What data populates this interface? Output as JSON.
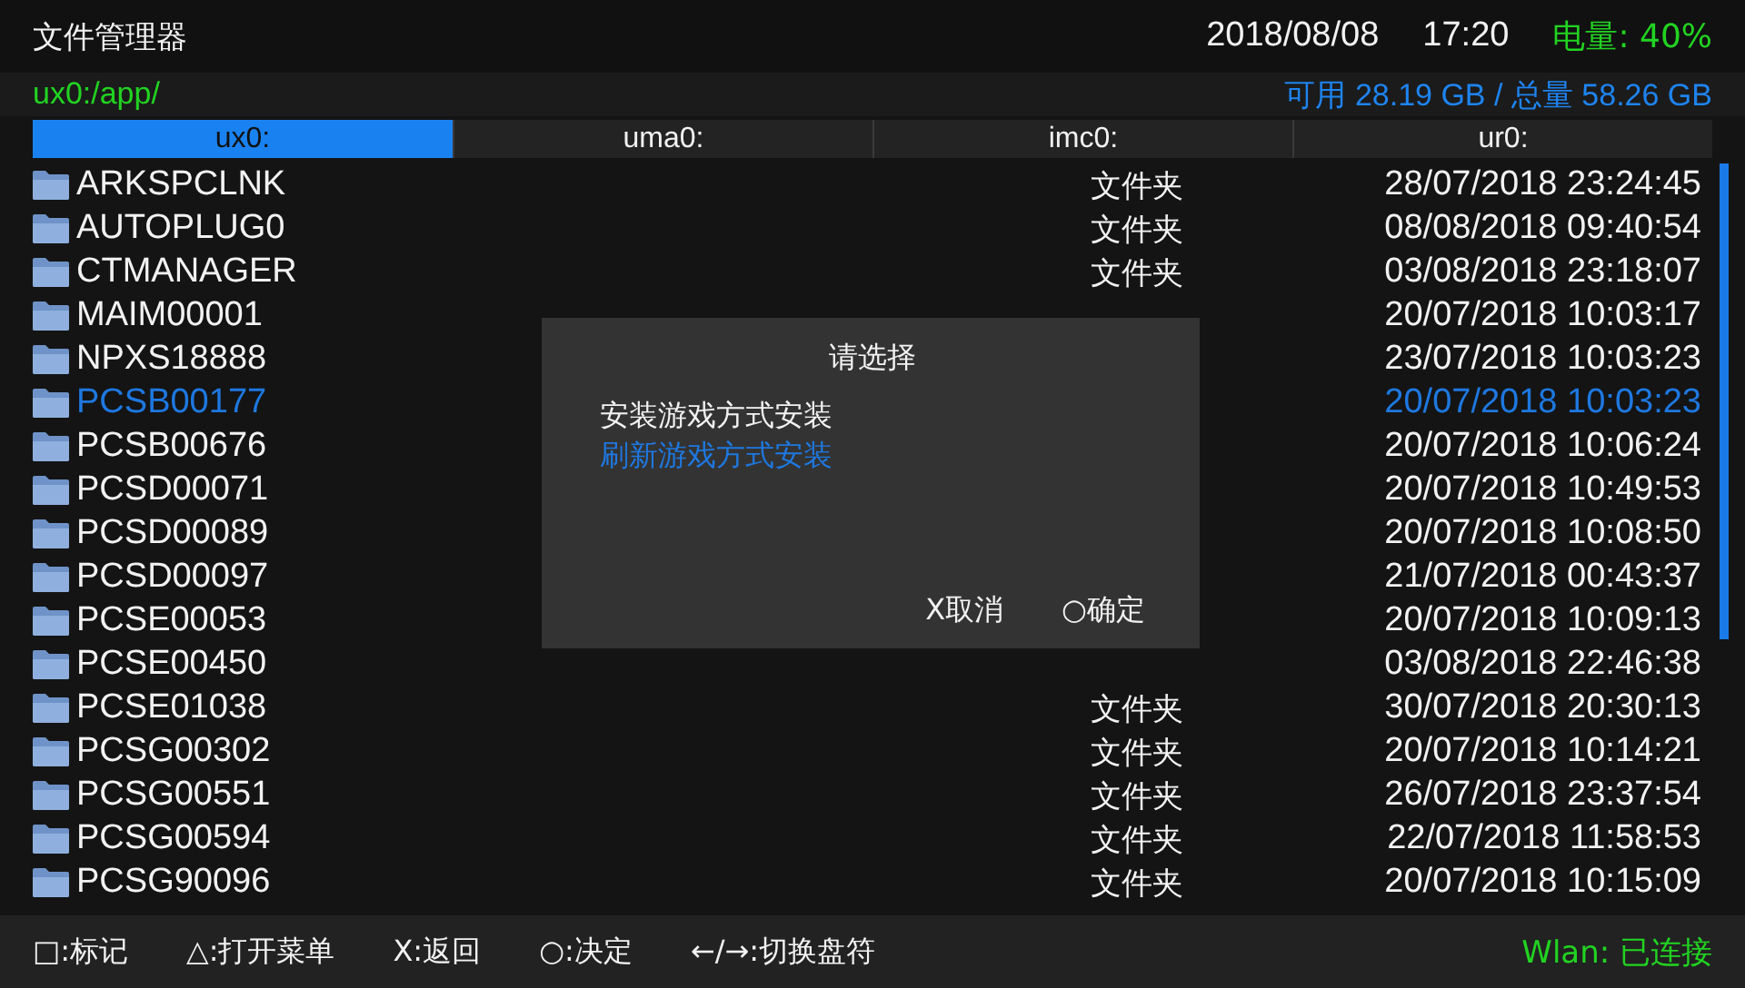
{
  "header": {
    "title": "文件管理器",
    "date": "2018/08/08",
    "time": "17:20",
    "battery": "电量: 40%"
  },
  "path": "ux0:/app/",
  "storage": "可用 28.19 GB  /  总量 58.26 GB",
  "tabs": [
    {
      "label": "ux0:",
      "selected": true
    },
    {
      "label": "uma0:",
      "selected": false
    },
    {
      "label": "imc0:",
      "selected": false
    },
    {
      "label": "ur0:",
      "selected": false
    }
  ],
  "files": [
    {
      "name": "ARKSPCLNK",
      "type": "文件夹",
      "date": "28/07/2018 23:24:45",
      "selected": false
    },
    {
      "name": "AUTOPLUG0",
      "type": "文件夹",
      "date": "08/08/2018 09:40:54",
      "selected": false
    },
    {
      "name": "CTMANAGER",
      "type": "文件夹",
      "date": "03/08/2018 23:18:07",
      "selected": false
    },
    {
      "name": "MAIM00001",
      "date": "20/07/2018 10:03:17",
      "selected": false
    },
    {
      "name": "NPXS18888",
      "date": "23/07/2018 10:03:23",
      "selected": false
    },
    {
      "name": "PCSB00177",
      "date": "20/07/2018 10:03:23",
      "selected": true
    },
    {
      "name": "PCSB00676",
      "date": "20/07/2018 10:06:24",
      "selected": false
    },
    {
      "name": "PCSD00071",
      "date": "20/07/2018 10:49:53",
      "selected": false
    },
    {
      "name": "PCSD00089",
      "date": "20/07/2018 10:08:50",
      "selected": false
    },
    {
      "name": "PCSD00097",
      "date": "21/07/2018 00:43:37",
      "selected": false
    },
    {
      "name": "PCSE00053",
      "date": "20/07/2018 10:09:13",
      "selected": false
    },
    {
      "name": "PCSE00450",
      "date": "03/08/2018 22:46:38",
      "selected": false
    },
    {
      "name": "PCSE01038",
      "type": "文件夹",
      "date": "30/07/2018 20:30:13",
      "selected": false
    },
    {
      "name": "PCSG00302",
      "type": "文件夹",
      "date": "20/07/2018 10:14:21",
      "selected": false
    },
    {
      "name": "PCSG00551",
      "type": "文件夹",
      "date": "26/07/2018 23:37:54",
      "selected": false
    },
    {
      "name": "PCSG00594",
      "type": "文件夹",
      "date": "22/07/2018 11:58:53",
      "selected": false
    },
    {
      "name": "PCSG90096",
      "type": "文件夹",
      "date": "20/07/2018 10:15:09",
      "selected": false
    }
  ],
  "dialog": {
    "title": "请选择",
    "options": [
      {
        "label": "安装游戏方式安装",
        "selected": false
      },
      {
        "label": "刷新游戏方式安装",
        "selected": true
      }
    ],
    "buttons": [
      "X取消",
      "○确定"
    ]
  },
  "hints": [
    "□:标记",
    "△:打开菜单",
    "X:返回",
    "○:决定",
    "←/→:切换盘符"
  ],
  "wlan": "Wlan: 已连接"
}
